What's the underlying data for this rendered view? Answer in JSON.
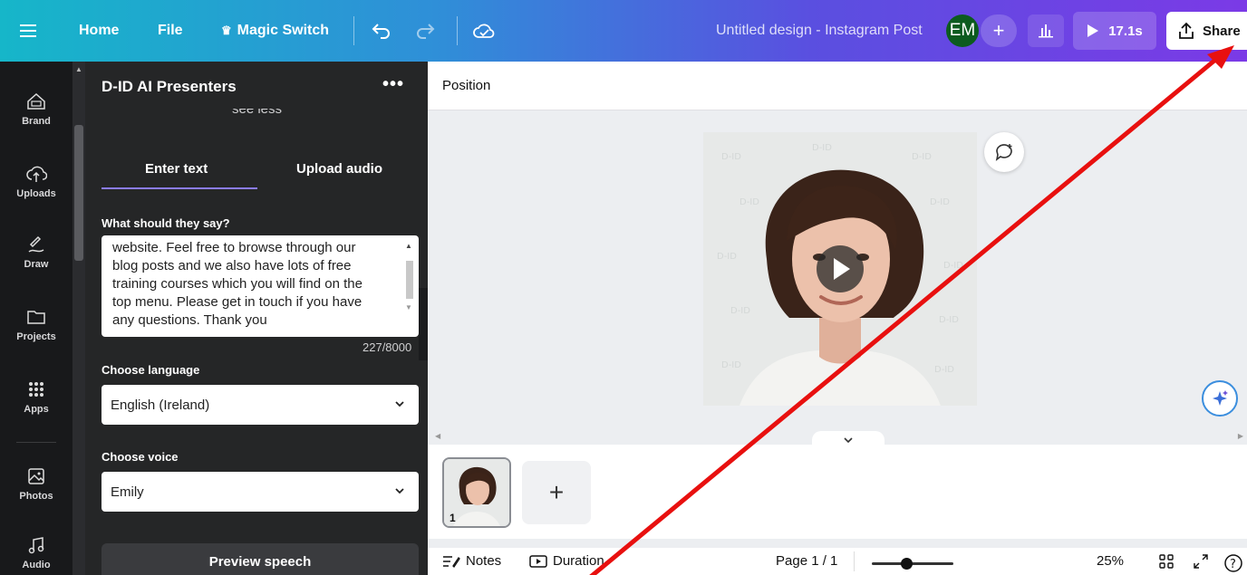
{
  "topbar": {
    "home": "Home",
    "file": "File",
    "magic_switch": "Magic Switch",
    "doc_title": "Untitled design - Instagram Post",
    "avatar_initials": "EM",
    "play_duration": "17.1s",
    "share": "Share"
  },
  "rail": {
    "items": [
      {
        "label": "Brand",
        "icon": "brand-icon"
      },
      {
        "label": "Uploads",
        "icon": "cloud-upload-icon"
      },
      {
        "label": "Draw",
        "icon": "draw-icon"
      },
      {
        "label": "Projects",
        "icon": "folder-icon"
      },
      {
        "label": "Apps",
        "icon": "apps-grid-icon"
      },
      {
        "label": "Photos",
        "icon": "image-icon"
      },
      {
        "label": "Audio",
        "icon": "music-icon"
      }
    ]
  },
  "panel": {
    "title": "D-ID AI Presenters",
    "see_less": "see less",
    "tabs": [
      {
        "label": "Enter text",
        "active": true
      },
      {
        "label": "Upload audio",
        "active": false
      }
    ],
    "prompt_label": "What should they say?",
    "script_text": "website. Feel free to browse through our blog posts and we also have lots of free training courses which you will find on the top menu. Please get in touch if you have any questions. Thank you",
    "char_count": "227/8000",
    "language_label": "Choose language",
    "language_value": "English (Ireland)",
    "voice_label": "Choose voice",
    "voice_value": "Emily",
    "preview_button": "Preview speech"
  },
  "canvas": {
    "toolbar_label": "Position",
    "accent": "#8b7cf7"
  },
  "pages": {
    "current_page_number": "1",
    "add_label": "+"
  },
  "footer": {
    "notes": "Notes",
    "duration": "Duration",
    "page_indicator": "Page 1 / 1",
    "zoom": "25%",
    "zoom_fraction": 0.42
  },
  "annotation": {
    "color": "#e8100f"
  }
}
